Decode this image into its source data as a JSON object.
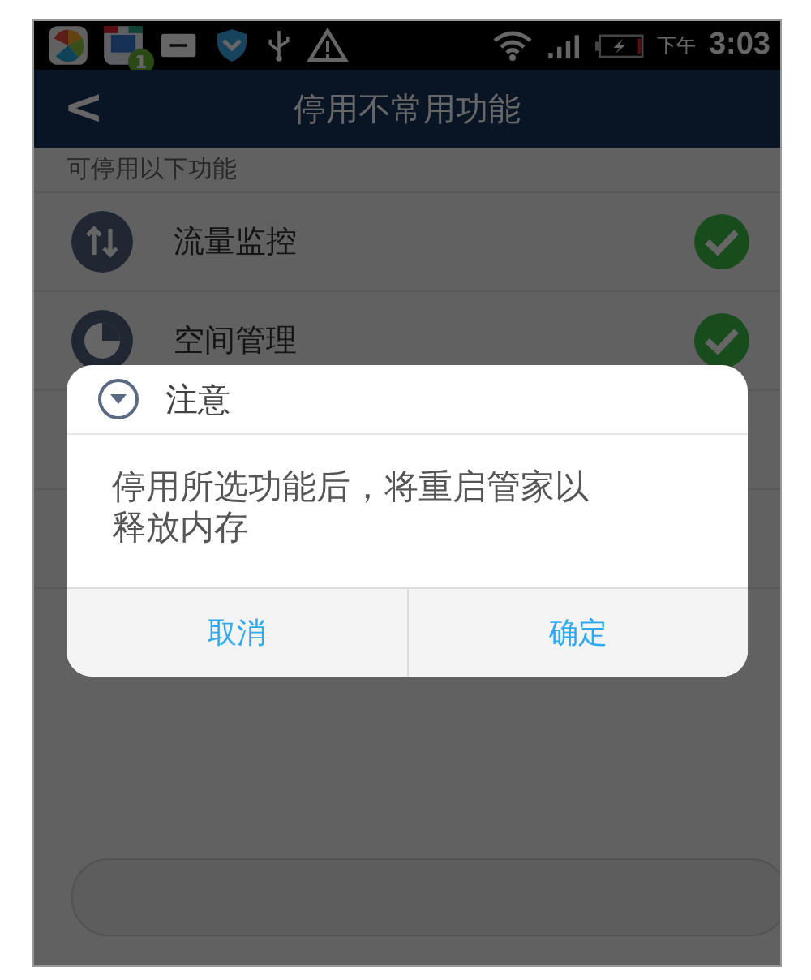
{
  "status_bar": {
    "badge": "1",
    "period": "下午",
    "time": "3:03"
  },
  "header": {
    "back": "<",
    "title": "停用不常用功能"
  },
  "section_label": "可停用以下功能",
  "features": [
    {
      "name": "流量监控",
      "kind": "arrows",
      "checked": true
    },
    {
      "name": "空间管理",
      "kind": "pie",
      "checked": true
    }
  ],
  "dialog": {
    "title": "注意",
    "message": "停用所选功能后，将重启管家以释放内存",
    "buttons": [
      "取消",
      "确定"
    ]
  }
}
